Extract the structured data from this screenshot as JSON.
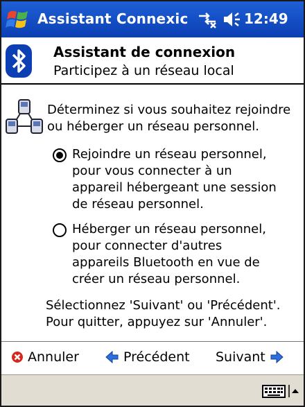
{
  "titlebar": {
    "app_title": "Assistant Connexic",
    "time": "12:49"
  },
  "header": {
    "title": "Assistant de connexion",
    "subtitle": "Participez à un réseau local"
  },
  "body": {
    "prompt": "Déterminez si vous souhaitez rejoindre ou héberger un réseau personnel.",
    "options": [
      {
        "label": "Rejoindre un réseau personnel, pour vous connecter à un appareil hébergeant une session de réseau personnel.",
        "selected": true
      },
      {
        "label": "Héberger un réseau personnel, pour connecter d'autres appareils Bluetooth en vue de créer un réseau personnel.",
        "selected": false
      }
    ],
    "note": "Sélectionnez 'Suivant' ou 'Précédent'. Pour quitter, appuyez sur 'Annuler'."
  },
  "nav": {
    "cancel": "Annuler",
    "previous": "Précédent",
    "next": "Suivant"
  },
  "colors": {
    "titlebar": "#0b3fb3",
    "menubar": "#e2ddd3",
    "cancel_icon": "#d8261e",
    "arrow_icon": "#2e6fe0"
  },
  "icons": [
    "windows-start-icon",
    "connectivity-icon",
    "volume-icon",
    "bluetooth-icon",
    "network-icon",
    "cancel-icon",
    "arrow-left-icon",
    "arrow-right-icon",
    "keyboard-icon",
    "sip-arrow-icon"
  ]
}
